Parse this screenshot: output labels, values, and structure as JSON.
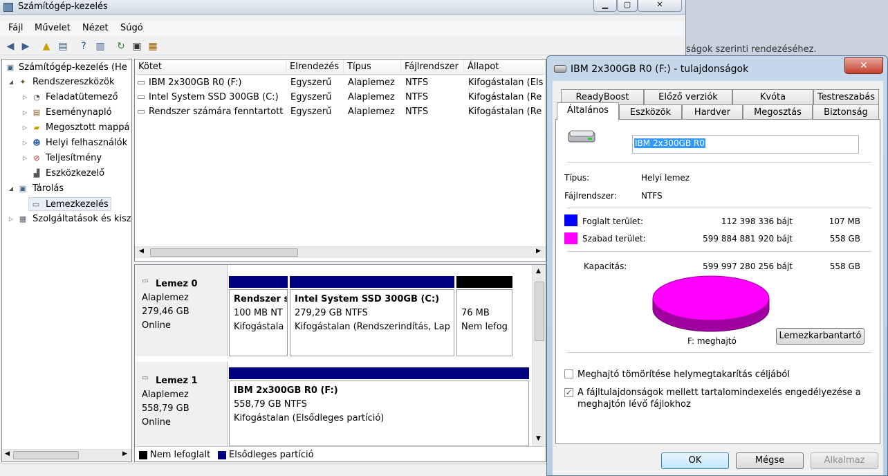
{
  "main_window": {
    "title": "Számítógép-kezelés",
    "menu": [
      "Fájl",
      "Művelet",
      "Nézet",
      "Súgó"
    ],
    "tree": [
      {
        "label": "Számítógép-kezelés (He",
        "level": 0
      },
      {
        "label": "Rendszereszközök",
        "level": 1
      },
      {
        "label": "Feladatütemező",
        "level": 2
      },
      {
        "label": "Eseménynapló",
        "level": 2
      },
      {
        "label": "Megosztott mappá",
        "level": 2
      },
      {
        "label": "Helyi felhasználók",
        "level": 2
      },
      {
        "label": "Teljesítmény",
        "level": 2
      },
      {
        "label": "Eszközkezelő",
        "level": 2
      },
      {
        "label": "Tárolás",
        "level": 1
      },
      {
        "label": "Lemezkezelés",
        "level": 2
      },
      {
        "label": "Szolgáltatások és kisz",
        "level": 1
      }
    ],
    "volume_table": {
      "columns": [
        "Kötet",
        "Elrendezés",
        "Típus",
        "Fájlrendszer",
        "Állapot"
      ],
      "rows": [
        [
          "IBM 2x300GB R0 (F:)",
          "Egyszerű",
          "Alaplemez",
          "NTFS",
          "Kifogástalan (Els"
        ],
        [
          "Intel System SSD 300GB (C:)",
          "Egyszerű",
          "Alaplemez",
          "NTFS",
          "Kifogástalan (Re"
        ],
        [
          "Rendszer számára fenntartott",
          "Egyszerű",
          "Alaplemez",
          "NTFS",
          "Kifogástalan (Re"
        ]
      ]
    },
    "disks": [
      {
        "name": "Lemez 0",
        "type": "Alaplemez",
        "size": "279,46 GB",
        "status": "Online",
        "partitions": [
          {
            "title": "Rendszer s",
            "size": "100 MB NT",
            "status": "Kifogástala"
          },
          {
            "title": "Intel System SSD 300GB  (C:)",
            "size": "279,29 GB NTFS",
            "status": "Kifogástalan (Rendszerindítás, Lap"
          },
          {
            "title": "",
            "size": "76 MB",
            "status": "Nem lefog"
          }
        ]
      },
      {
        "name": "Lemez 1",
        "type": "Alaplemez",
        "size": "558,79 GB",
        "status": "Online",
        "partitions": [
          {
            "title": "IBM 2x300GB R0  (F:)",
            "size": "558,79 GB NTFS",
            "status": "Kifogástalan (Elsődleges partíció)"
          }
        ]
      }
    ],
    "legend": [
      {
        "label": "Nem lefoglalt",
        "color": "#000000"
      },
      {
        "label": "Elsődleges partíció",
        "color": "#000080"
      }
    ],
    "background_text": "ságok szerinti rendezéséhez."
  },
  "dialog": {
    "title": "IBM 2x300GB R0 (F:) - tulajdonságok",
    "close_glyph": "✕",
    "tabs_row1": [
      "ReadyBoost",
      "Előző verziók",
      "Kvóta",
      "Testreszabás"
    ],
    "tabs_row2": [
      "Általános",
      "Eszközök",
      "Hardver",
      "Megosztás",
      "Biztonság"
    ],
    "label_value": "IBM 2x300GB R0",
    "type_label": "Típus:",
    "type_value": "Helyi lemez",
    "fs_label": "Fájlrendszer:",
    "fs_value": "NTFS",
    "used": {
      "label": "Foglalt terület:",
      "bytes": "112 398 336 bájt",
      "size": "107 MB",
      "color": "#0000ff"
    },
    "free": {
      "label": "Szabad terület:",
      "bytes": "599 884 881 920 bájt",
      "size": "558 GB",
      "color": "#ff00ff"
    },
    "capacity": {
      "label": "Kapacitás:",
      "bytes": "599 997 280 256 bájt",
      "size": "558 GB"
    },
    "used_fraction": 0.0002,
    "drive_label": "F: meghajtó",
    "cleanup_button": "Lemezkarbantartó",
    "compress_label": "Meghajtó tömörítése helymegtakarítás céljából",
    "compress_checked": false,
    "index_label_line1": "A fájltulajdonságok mellett tartalomindexelés engedélyezése a",
    "index_label_line2": "meghajtón lévő fájlokhoz",
    "index_checked": true,
    "check_glyph": "✓",
    "ok_button": "OK",
    "cancel_button": "Mégse",
    "apply_button": "Alkalmaz"
  }
}
